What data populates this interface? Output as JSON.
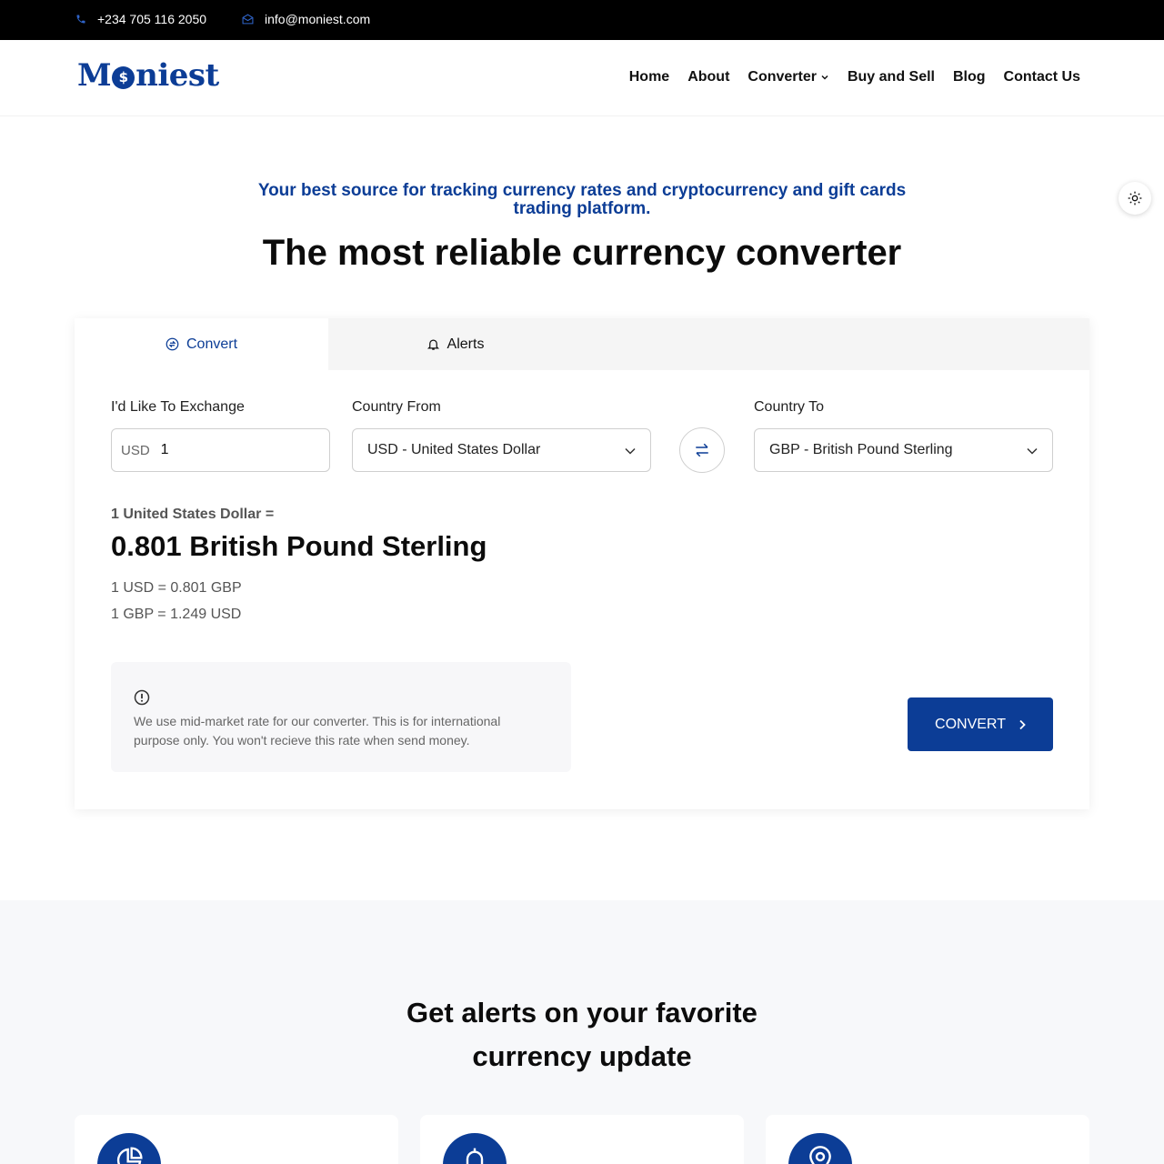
{
  "topbar": {
    "phone": "+234 705 116 2050",
    "email": "info@moniest.com"
  },
  "brand": {
    "logo_left": "M",
    "logo_coin": "$",
    "logo_right": "niest"
  },
  "nav": {
    "items": [
      "Home",
      "About",
      "Converter",
      "Buy and Sell",
      "Blog",
      "Contact Us"
    ]
  },
  "hero": {
    "tagline": "Your best source for tracking currency rates and cryptocurrency and gift cards trading platform.",
    "title": "The most reliable currency converter"
  },
  "tabs": {
    "convert": "Convert",
    "alerts": "Alerts"
  },
  "form": {
    "exchange_label": "I'd Like To Exchange",
    "currency_prefix": "USD",
    "amount": "1",
    "from_label": "Country From",
    "from_value": "USD - United States Dollar",
    "to_label": "Country To",
    "to_value": "GBP - British Pound Sterling"
  },
  "result": {
    "pre": "1 United States Dollar =",
    "main": "0.801 British Pound Sterling",
    "rate1": "1 USD = 0.801 GBP",
    "rate2": "1 GBP = 1.249 USD"
  },
  "notice": {
    "text": "We use mid-market rate for our converter. This is for international purpose only. You won't recieve this rate when send money."
  },
  "convert_button": {
    "label": "CONVERT"
  },
  "alerts_section": {
    "title_line1": "Get alerts on your favorite",
    "title_line2": "currency update"
  },
  "colors": {
    "brand": "#0c3d96",
    "topbar": "#000000",
    "section_bg": "#f7f8fa"
  }
}
